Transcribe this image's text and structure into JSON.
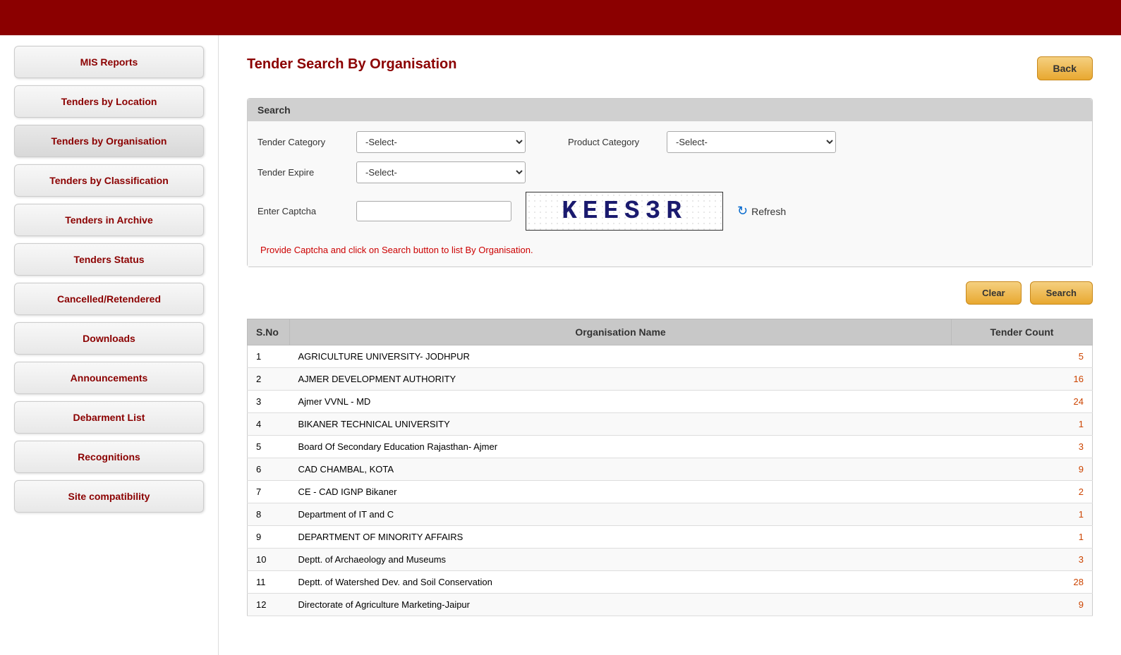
{
  "topBar": {},
  "sidebar": {
    "items": [
      {
        "id": "mis-reports",
        "label": "MIS Reports"
      },
      {
        "id": "tenders-by-location",
        "label": "Tenders by Location"
      },
      {
        "id": "tenders-by-organisation",
        "label": "Tenders by Organisation",
        "active": true
      },
      {
        "id": "tenders-by-classification",
        "label": "Tenders by Classification"
      },
      {
        "id": "tenders-in-archive",
        "label": "Tenders in Archive"
      },
      {
        "id": "tenders-status",
        "label": "Tenders Status"
      },
      {
        "id": "cancelled-retendered",
        "label": "Cancelled/Retendered"
      },
      {
        "id": "downloads",
        "label": "Downloads"
      },
      {
        "id": "announcements",
        "label": "Announcements"
      },
      {
        "id": "debarment-list",
        "label": "Debarment List"
      },
      {
        "id": "recognitions",
        "label": "Recognitions"
      },
      {
        "id": "site-compatibility",
        "label": "Site compatibility"
      }
    ]
  },
  "page": {
    "title": "Tender Search By Organisation",
    "backButton": "Back"
  },
  "search": {
    "sectionLabel": "Search",
    "tenderCategoryLabel": "Tender Category",
    "tenderCategoryDefault": "-Select-",
    "productCategoryLabel": "Product Category",
    "productCategoryDefault": "-Select-",
    "tenderExpireLabel": "Tender Expire",
    "tenderExpireDefault": "-Select-",
    "enterCaptchaLabel": "Enter Captcha",
    "captchaText": "KEES3R",
    "captchaInputPlaceholder": "",
    "refreshLabel": "Refresh",
    "infoText": "Provide Captcha and click on Search button to list By Organisation.",
    "clearButton": "Clear",
    "searchButton": "Search"
  },
  "table": {
    "headers": [
      "S.No",
      "Organisation Name",
      "Tender Count"
    ],
    "rows": [
      {
        "sno": "1",
        "name": "AGRICULTURE UNIVERSITY- JODHPUR",
        "count": "5"
      },
      {
        "sno": "2",
        "name": "AJMER DEVELOPMENT AUTHORITY",
        "count": "16"
      },
      {
        "sno": "3",
        "name": "Ajmer VVNL - MD",
        "count": "24"
      },
      {
        "sno": "4",
        "name": "BIKANER TECHNICAL UNIVERSITY",
        "count": "1"
      },
      {
        "sno": "5",
        "name": "Board Of Secondary Education Rajasthan- Ajmer",
        "count": "3"
      },
      {
        "sno": "6",
        "name": "CAD CHAMBAL, KOTA",
        "count": "9"
      },
      {
        "sno": "7",
        "name": "CE - CAD IGNP Bikaner",
        "count": "2"
      },
      {
        "sno": "8",
        "name": "Department of IT and C",
        "count": "1"
      },
      {
        "sno": "9",
        "name": "DEPARTMENT OF MINORITY AFFAIRS",
        "count": "1"
      },
      {
        "sno": "10",
        "name": "Deptt. of Archaeology and Museums",
        "count": "3"
      },
      {
        "sno": "11",
        "name": "Deptt. of Watershed Dev. and Soil Conservation",
        "count": "28"
      },
      {
        "sno": "12",
        "name": "Directorate of Agriculture Marketing-Jaipur",
        "count": "9"
      }
    ]
  }
}
